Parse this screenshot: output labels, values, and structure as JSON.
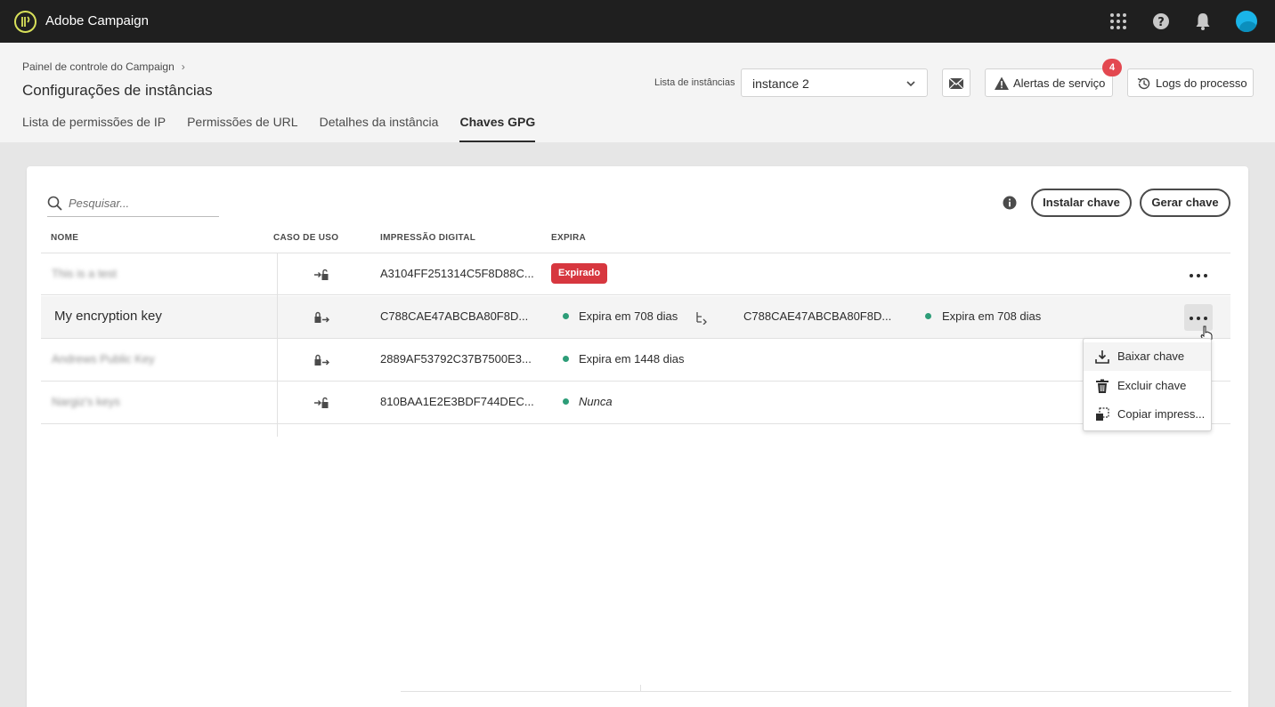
{
  "app": {
    "title": "Adobe Campaign"
  },
  "topbar": {
    "icons": [
      "apps-grid-icon",
      "help-icon",
      "bell-icon",
      "avatar"
    ]
  },
  "breadcrumb": {
    "parent": "Painel de controle do Campaign"
  },
  "page": {
    "title": "Configurações de instâncias"
  },
  "tabs": [
    {
      "label": "Lista de permissões de IP",
      "active": false
    },
    {
      "label": "Permissões de URL",
      "active": false
    },
    {
      "label": "Detalhes da instância",
      "active": false
    },
    {
      "label": "Chaves GPG",
      "active": true
    }
  ],
  "instance": {
    "label": "Lista de instâncias",
    "selected": "instance 2"
  },
  "actions": {
    "service_alerts": "Alertas de serviço",
    "service_alerts_count": "4",
    "process_logs": "Logs do processo"
  },
  "search": {
    "placeholder": "Pesquisar..."
  },
  "buttons": {
    "install": "Instalar chave",
    "generate": "Gerar chave"
  },
  "columns": {
    "name": "NOME",
    "use_case": "CASO DE USO",
    "fingerprint": "IMPRESSÃO DIGITAL",
    "expires": "EXPIRA"
  },
  "rows": [
    {
      "name": "This is a test",
      "use_case_icon": "decrypt-key-icon",
      "fingerprint": "A3104FF251314C5F8D88C...",
      "expires": "Expirado",
      "status": "expired"
    },
    {
      "name": "My encryption key",
      "use_case_icon": "encrypt-key-icon",
      "fingerprint": "C788CAE47ABCBA80F8D...",
      "expires": "Expira em 708 dias",
      "status": "active",
      "ghost_fingerprint": "C788CAE47ABCBA80F8D...",
      "ghost_expires": "Expira em 708 dias"
    },
    {
      "name": "Andrews Public Key",
      "use_case_icon": "encrypt-key-icon",
      "fingerprint": "2889AF53792C37B7500E3...",
      "expires": "Expira em 1448 dias",
      "status": "active"
    },
    {
      "name": "Nargiz's keys",
      "use_case_icon": "decrypt-key-icon",
      "fingerprint": "810BAA1E2E3BDF744DEC...",
      "expires": "Nunca",
      "status": "never"
    }
  ],
  "menu": {
    "download": "Baixar chave",
    "delete": "Excluir chave",
    "copy": "Copiar impress..."
  },
  "colors": {
    "accent": "#2d9d78",
    "danger": "#d7373f",
    "badge": "#e34850",
    "topbar": "#1f1f1f"
  }
}
